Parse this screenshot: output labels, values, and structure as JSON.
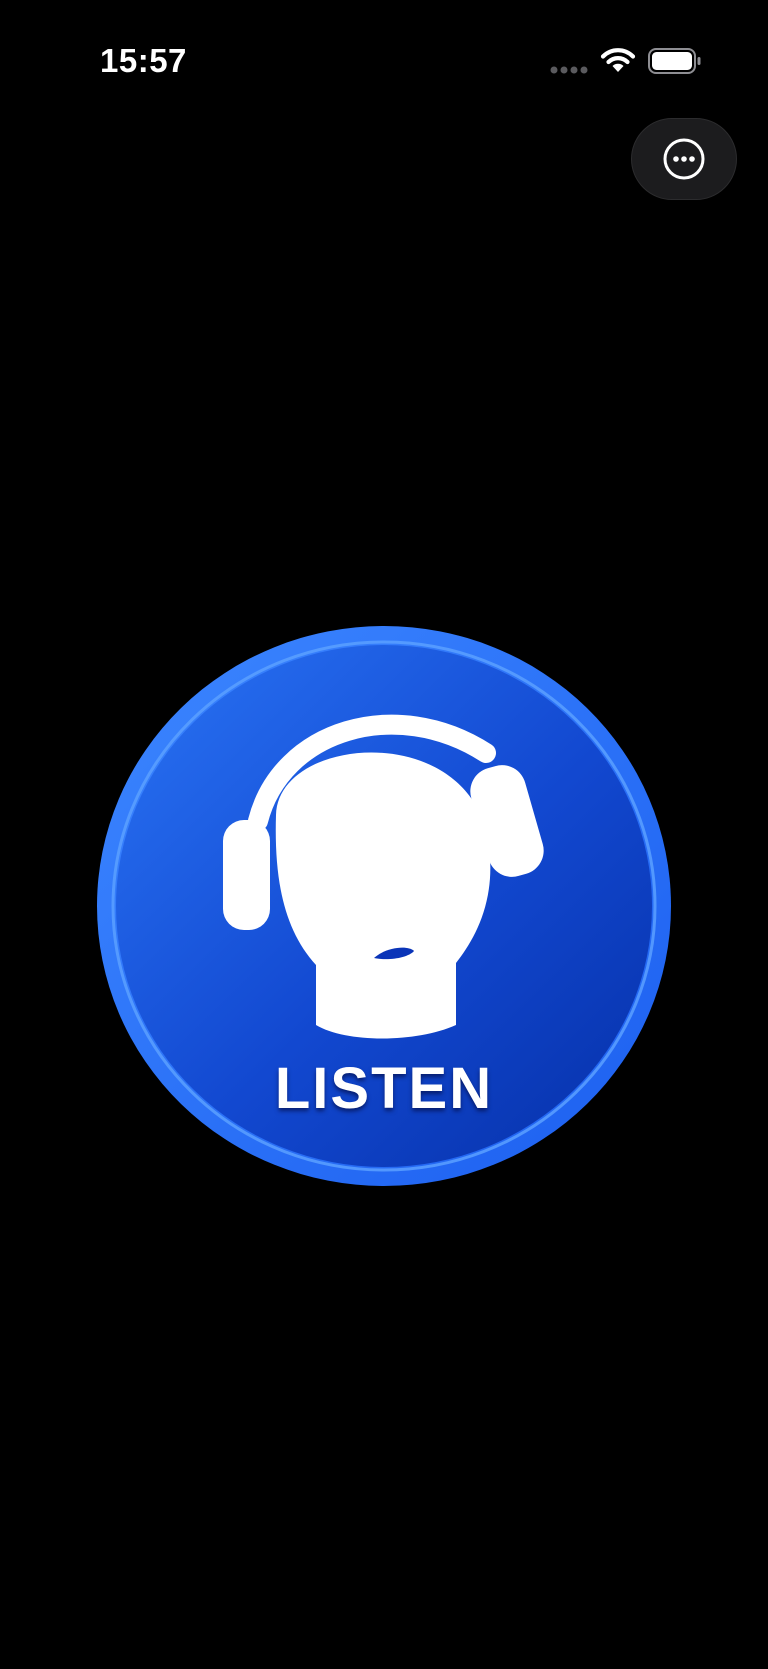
{
  "status_bar": {
    "time": "15:57",
    "icons": [
      "signal-dots-icon",
      "wifi-icon",
      "battery-icon"
    ]
  },
  "header": {
    "more_button_icon": "ellipsis-circle-icon"
  },
  "main": {
    "listen_label": "LISTEN",
    "listen_icon": "headphones-head-icon"
  },
  "colors": {
    "background": "#000000",
    "button_blue_light": "#1f6bf2",
    "button_blue_dark": "#0a34b8",
    "button_rim": "#2b7bff",
    "glyph": "#ffffff"
  }
}
